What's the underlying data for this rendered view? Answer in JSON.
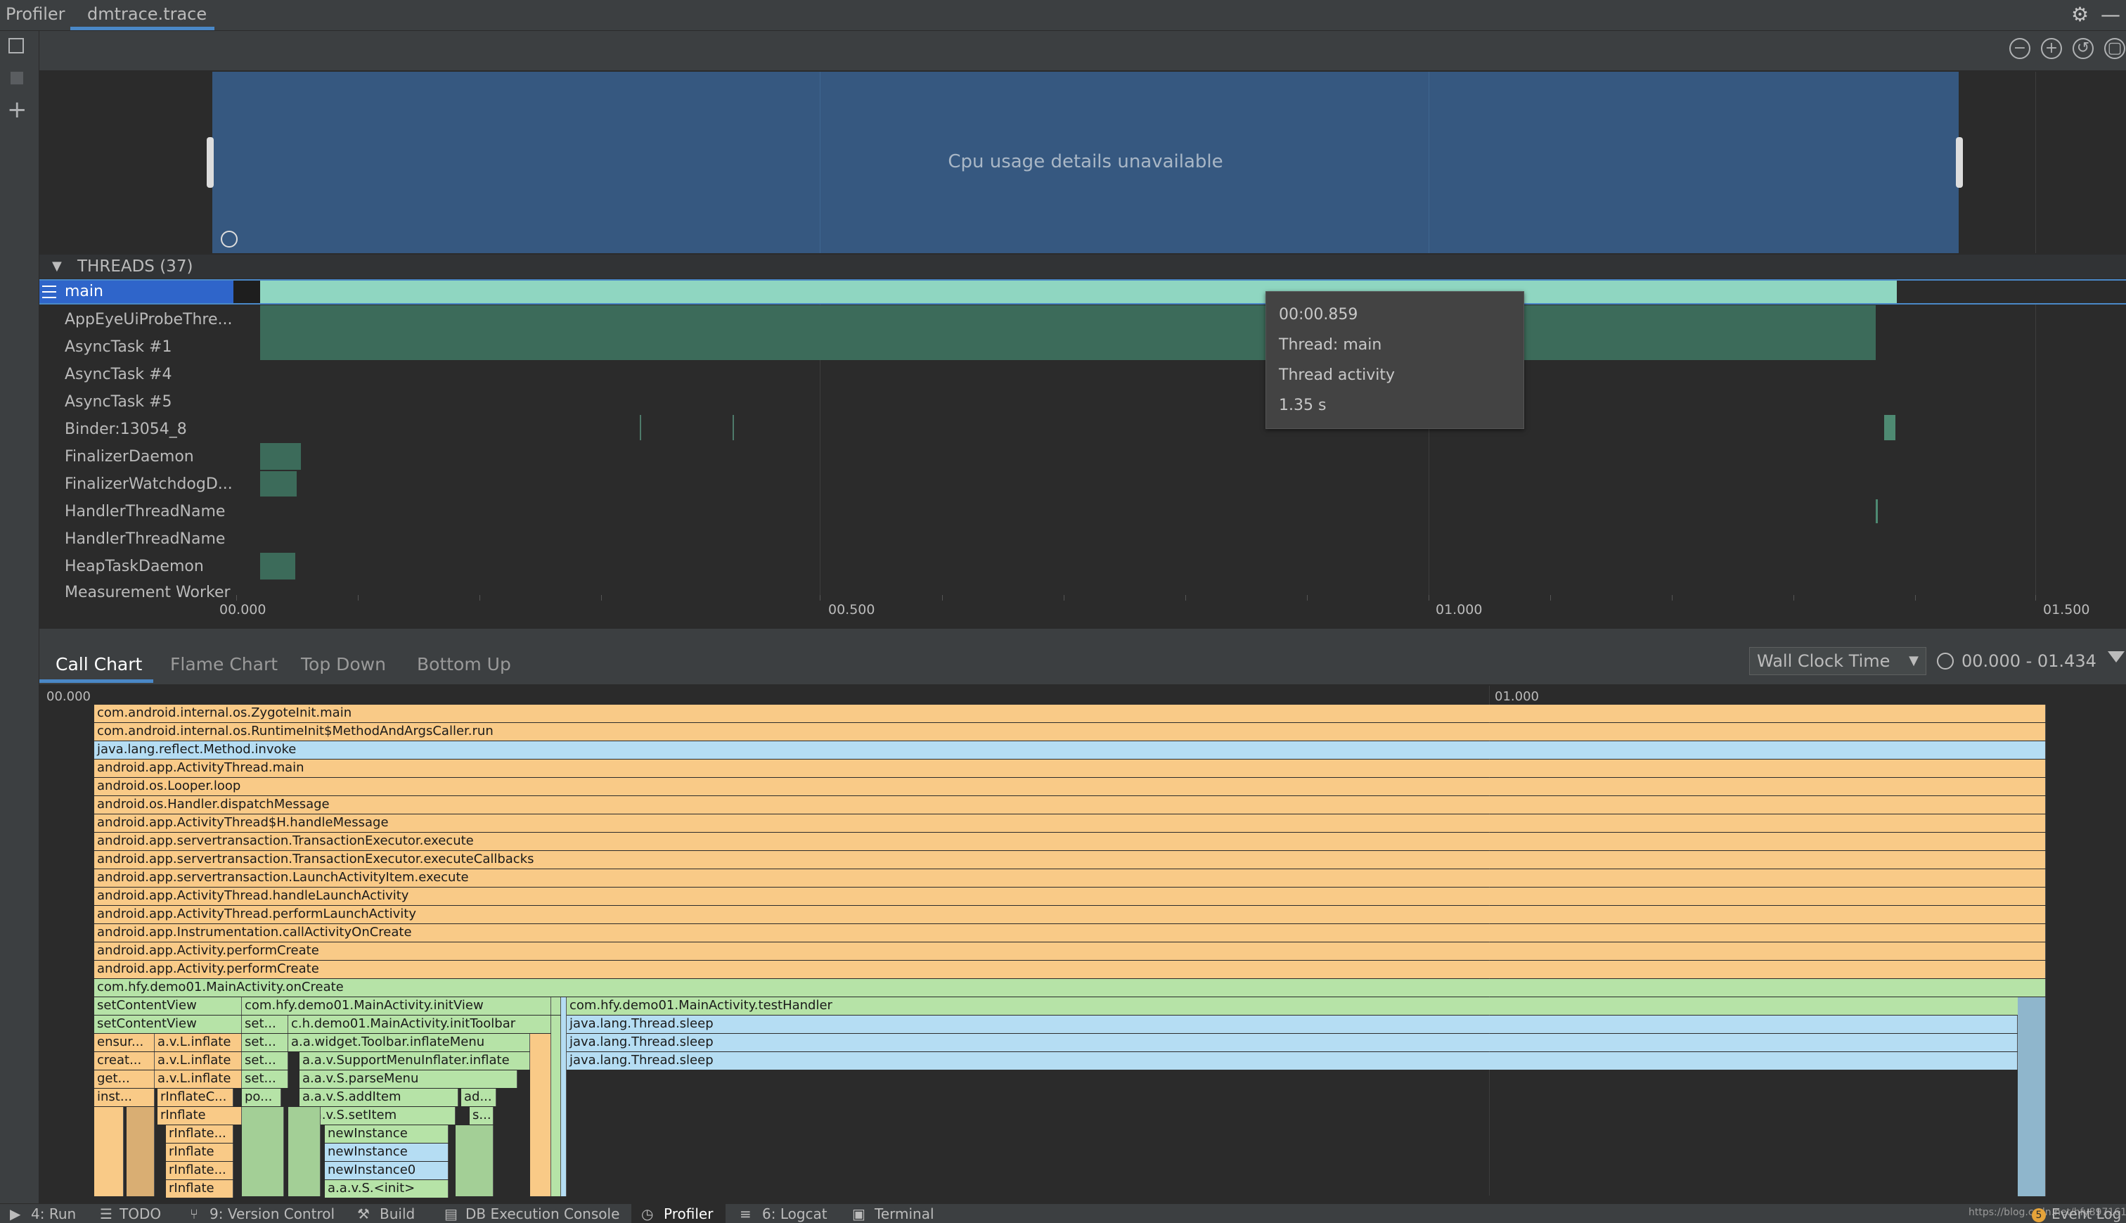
{
  "topbar": {
    "app_title": "Profiler",
    "session_tab": "dmtrace.trace"
  },
  "icons": {
    "settings": "gear-icon",
    "minimize": "minimize-icon"
  },
  "cpu": {
    "message": "Cpu usage details unavailable"
  },
  "threads": {
    "header": "THREADS (37)",
    "items": [
      "main",
      "AppEyeUiProbeThre...",
      "AsyncTask #1",
      "AsyncTask #4",
      "AsyncTask #5",
      "Binder:13054_8",
      "FinalizerDaemon",
      "FinalizerWatchdogD...",
      "HandlerThreadName",
      "HandlerThreadName",
      "HeapTaskDaemon",
      "Measurement Worker"
    ]
  },
  "timeline": {
    "ticks": [
      "00.000",
      "00.500",
      "01.000",
      "01.500"
    ]
  },
  "tooltip": {
    "time": "00:00.859",
    "thread": "Thread: main",
    "title": "Thread activity",
    "duration": "1.35 s"
  },
  "callchart": {
    "tabs": [
      "Call Chart",
      "Flame Chart",
      "Top Down",
      "Bottom Up"
    ],
    "clock": "Wall Clock Time",
    "range": "00.000 - 01.434",
    "ticks": [
      "00.000",
      "01.000"
    ],
    "stack": [
      "com.android.internal.os.ZygoteInit.main",
      "com.android.internal.os.RuntimeInit$MethodAndArgsCaller.run",
      "java.lang.reflect.Method.invoke",
      "android.app.ActivityThread.main",
      "android.os.Looper.loop",
      "android.os.Handler.dispatchMessage",
      "android.app.ActivityThread$H.handleMessage",
      "android.app.servertransaction.TransactionExecutor.execute",
      "android.app.servertransaction.TransactionExecutor.executeCallbacks",
      "android.app.servertransaction.LaunchActivityItem.execute",
      "android.app.ActivityThread.handleLaunchActivity",
      "android.app.ActivityThread.performLaunchActivity",
      "android.app.Instrumentation.callActivityOnCreate",
      "android.app.Activity.performCreate",
      "android.app.Activity.performCreate",
      "com.hfy.demo01.MainActivity.onCreate"
    ],
    "row16": [
      "setContentView",
      "com.hfy.demo01.MainActivity.initView",
      "com.hfy.demo01.MainActivity.testHandler"
    ],
    "row17": [
      "setContentView",
      "set...",
      "c.h.demo01.MainActivity.initToolbar",
      "java.lang.Thread.sleep"
    ],
    "row18": [
      "ensur...",
      "a.v.L.inflate",
      "set...",
      "a.a.widget.Toolbar.inflateMenu",
      "java.lang.Thread.sleep"
    ],
    "row19": [
      "creat...",
      "a.v.L.inflate",
      "set...",
      "a.a.v.SupportMenuInflater.inflate",
      "java.lang.Thread.sleep"
    ],
    "row20": [
      "get...",
      "a.v.L.inflate",
      "set...",
      "a.a.v.S.parseMenu"
    ],
    "row21": [
      "inst...",
      "rInflateC...",
      "po...",
      "a.a.v.S.addItem",
      "ad..."
    ],
    "row22": [
      "rInflate",
      "a.a.v.S.setItem",
      "s..."
    ],
    "row23": [
      "rInflate...",
      "newInstance"
    ],
    "row24": [
      "rInflate",
      "newInstance"
    ],
    "row25": [
      "rInflate...",
      "newInstance0"
    ],
    "row26": [
      "rInflate",
      "a.a.v.S.<init>"
    ]
  },
  "bottombar": {
    "items": [
      "4: Run",
      "TODO",
      "9: Version Control",
      "Build",
      "DB Execution Console",
      "Profiler",
      "6: Logcat",
      "Terminal"
    ],
    "event_count": "5",
    "event_log": "Event Log",
    "watermark": "https://blog.csdn.net/hfy8971613"
  }
}
